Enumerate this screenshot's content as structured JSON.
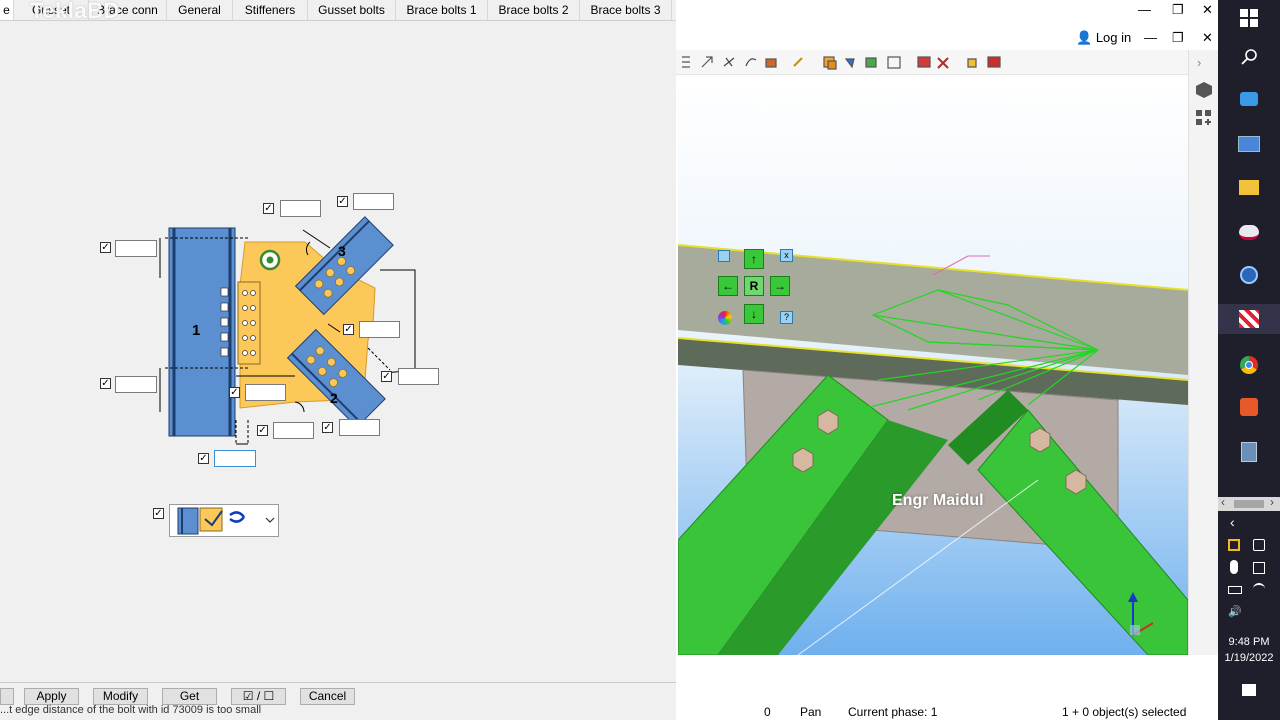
{
  "dialog": {
    "watermark": "TeklaBD",
    "tabs": [
      "e",
      "Gusset",
      "Brace conn",
      "General",
      "Stiffeners",
      "Gusset bolts",
      "Brace bolts 1",
      "Brace bolts 2",
      "Brace bolts 3"
    ],
    "diagram_labels": {
      "column": "1",
      "brace_top": "3",
      "brace_bottom": "2"
    },
    "buttons": {
      "apply": "Apply",
      "modify": "Modify",
      "get": "Get",
      "toggle": "☑ / ☐",
      "cancel": "Cancel"
    },
    "status_message": "...t edge distance of the bolt with id 73009 is too small"
  },
  "window": {
    "login": "Log in",
    "minimize": "—",
    "restore": "❐",
    "close": "✕"
  },
  "viewport": {
    "watermark": "Engr Maidul",
    "nav": {
      "up": "↑",
      "down": "↓",
      "left": "←",
      "right": "→",
      "rotate": "R",
      "close": "x",
      "help": "?"
    }
  },
  "statusbar": {
    "zero": "0",
    "mode": "Pan",
    "phase": "Current phase: 1",
    "selection": "1 + 0 object(s) selected"
  },
  "taskbar": {
    "time": "9:48 PM",
    "date": "1/19/2022"
  },
  "colors": {
    "steel_blue": "#5b8fcf",
    "gusset_orange": "#fcc85a",
    "brace_green": "#3ac43a",
    "beam_olive": "#8b9a7a",
    "sky_blue": "#79b8f0",
    "taskbar": "#1f1f2c"
  }
}
